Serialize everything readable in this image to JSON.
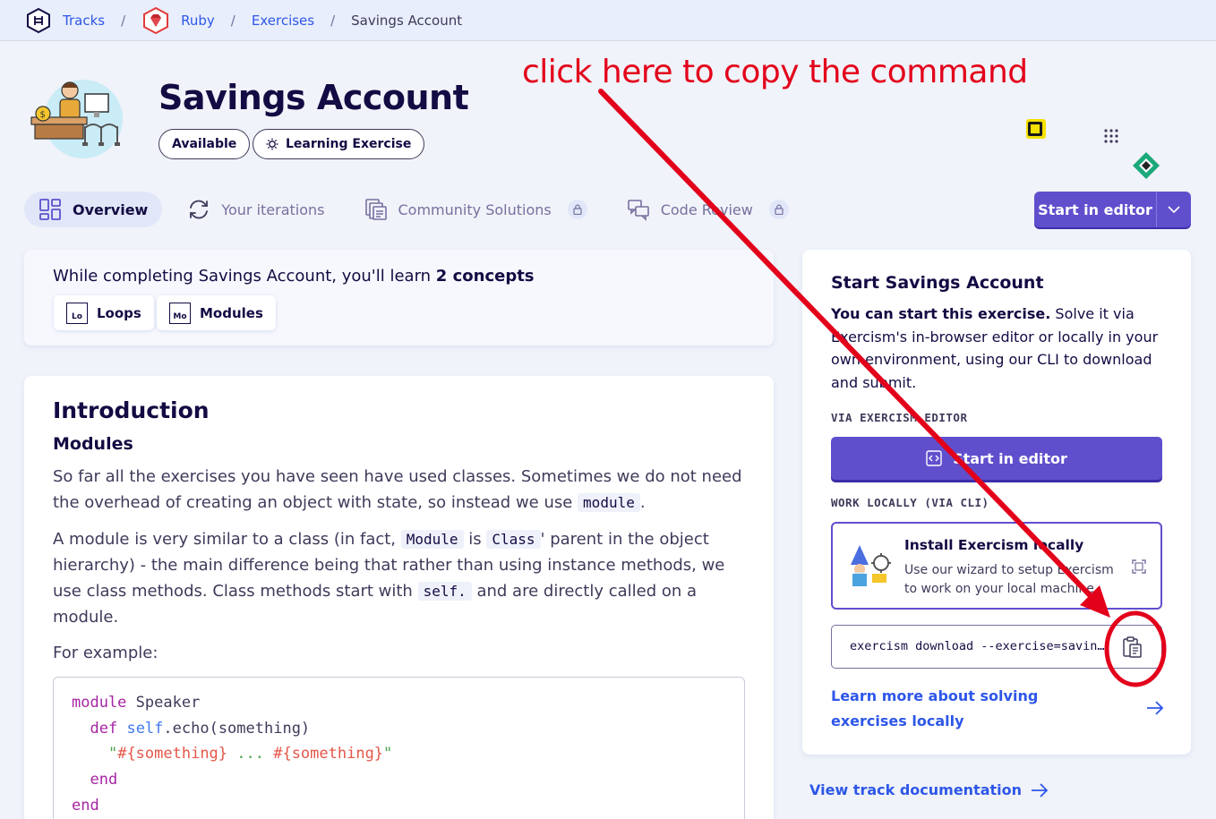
{
  "breadcrumb": {
    "tracks": "Tracks",
    "ruby": "Ruby",
    "exercises": "Exercises",
    "current": "Savings Account"
  },
  "header": {
    "title": "Savings Account",
    "status_pill": "Available",
    "type_pill": "Learning Exercise"
  },
  "annotation": {
    "text": "click here to copy the command",
    "color": "#e3001b"
  },
  "tabs": [
    {
      "label": "Overview",
      "active": true
    },
    {
      "label": "Your iterations"
    },
    {
      "label": "Community Solutions",
      "locked": true
    },
    {
      "label": "Code Review",
      "locked": true
    }
  ],
  "start_button": {
    "label": "Start in editor"
  },
  "concepts": {
    "heading_prefix": "While completing Savings Account, you'll learn ",
    "heading_count": "2 concepts",
    "items": [
      {
        "abbr": "Lo",
        "label": "Loops"
      },
      {
        "abbr": "Mo",
        "label": "Modules"
      }
    ]
  },
  "intro": {
    "title": "Introduction",
    "subtitle": "Modules",
    "p1_a": "So far all the exercises you have seen have used classes. Sometimes we do not need the overhead of creating an object with state, so instead we use ",
    "p1_code": "module",
    "p1_b": ".",
    "p2_a": "A module is very similar to a class (in fact, ",
    "p2_code1": "Module",
    "p2_b": " is ",
    "p2_code2": "Class",
    "p2_c": "' parent in the object hierarchy) - the main difference being that rather than using instance methods, we use class methods. Class methods start with ",
    "p2_code3": "self.",
    "p2_d": " and are directly called on a module.",
    "p3": "For example:",
    "code": {
      "l1_kw": "module",
      "l1_name": " Speaker",
      "l2_kw": "def",
      "l2_self": "self",
      "l2_rest": ".echo(something)",
      "l3_q1": "\"",
      "l3_i1": "#{something}",
      "l3_mid": " ... ",
      "l3_i2": "#{something}",
      "l3_q2": "\"",
      "l4": "end",
      "l5": "end"
    }
  },
  "side": {
    "heading": "Start Savings Account",
    "text_bold": "You can start this exercise.",
    "text_rest": " Solve it via Exercism's in-browser editor or locally in your own environment, using our CLI to download and submit.",
    "via_editor_label": "VIA EXERCISM EDITOR",
    "editor_button": "Start in editor",
    "work_locally_label": "WORK LOCALLY (VIA CLI)",
    "install_title": "Install Exercism locally",
    "install_desc": "Use our wizard to setup Exercism to work on your local machine.",
    "cli_command": "exercism download --exercise=savings-account --track=ruby",
    "learn_more": "Learn more about solving exercises locally",
    "view_docs": "View track documentation"
  },
  "colors": {
    "primary": "#604fcd",
    "link": "#2e57e8",
    "annotation": "#e3001b"
  }
}
